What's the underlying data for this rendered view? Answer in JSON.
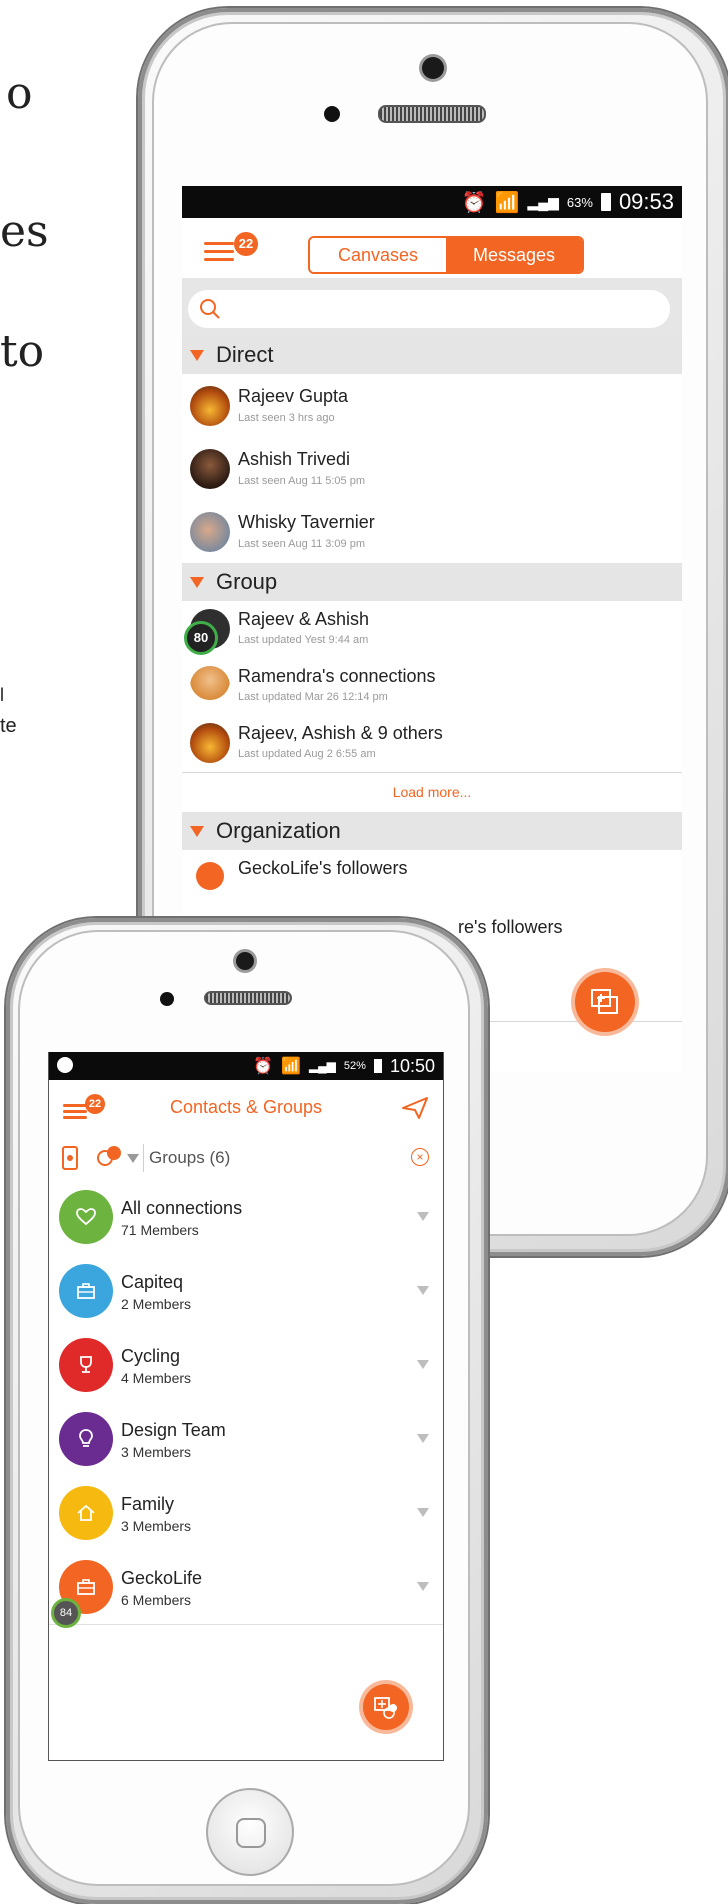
{
  "background_text": {
    "line1": "o",
    "line2": "es",
    "line3": "to",
    "line4": "l",
    "line5": "te"
  },
  "phone1": {
    "status": {
      "battery": "63%",
      "time": "09:53"
    },
    "header": {
      "badge": "22",
      "tab_canvases": "Canvases",
      "tab_messages": "Messages",
      "active_tab": "Messages"
    },
    "search": {
      "placeholder": ""
    },
    "sections": {
      "direct": "Direct",
      "group": "Group",
      "organization": "Organization"
    },
    "direct": [
      {
        "name": "Rajeev Gupta",
        "sub": "Last seen 3 hrs ago"
      },
      {
        "name": "Ashish Trivedi",
        "sub": "Last seen Aug 11  5:05 pm"
      },
      {
        "name": "Whisky Tavernier",
        "sub": "Last seen Aug 11  3:09 pm"
      }
    ],
    "group": [
      {
        "name": "Rajeev & Ashish",
        "sub": "Last updated Yest 9:44 am",
        "badge": "80"
      },
      {
        "name": "Ramendra's connections",
        "sub": "Last updated Mar 26 12:14 pm"
      },
      {
        "name": "Rajeev, Ashish & 9 others",
        "sub": "Last updated Aug 2  6:55 am"
      }
    ],
    "load_more": "Load more...",
    "organization": [
      {
        "name": "GeckoLife's followers"
      },
      {
        "name": "re's followers"
      }
    ]
  },
  "phone2": {
    "status": {
      "battery": "52%",
      "time": "10:50"
    },
    "header": {
      "badge": "22",
      "title": "Contacts & Groups"
    },
    "filter": {
      "label": "Groups (6)"
    },
    "groups": [
      {
        "name": "All connections",
        "count": "71 Members",
        "color": "#6db33f",
        "icon": "heart-icon"
      },
      {
        "name": "Capiteq",
        "count": "2 Members",
        "color": "#3aa6dd",
        "icon": "briefcase-icon"
      },
      {
        "name": "Cycling",
        "count": "4 Members",
        "color": "#e02a2a",
        "icon": "trophy-icon"
      },
      {
        "name": "Design Team",
        "count": "3 Members",
        "color": "#6a2c91",
        "icon": "bulb-icon"
      },
      {
        "name": "Family",
        "count": "3 Members",
        "color": "#f5b90f",
        "icon": "home-icon"
      },
      {
        "name": "GeckoLife",
        "count": "6 Members",
        "color": "#f26522",
        "icon": "briefcase-icon"
      }
    ],
    "progress_badge": "84"
  },
  "colors": {
    "accent": "#f26522"
  }
}
